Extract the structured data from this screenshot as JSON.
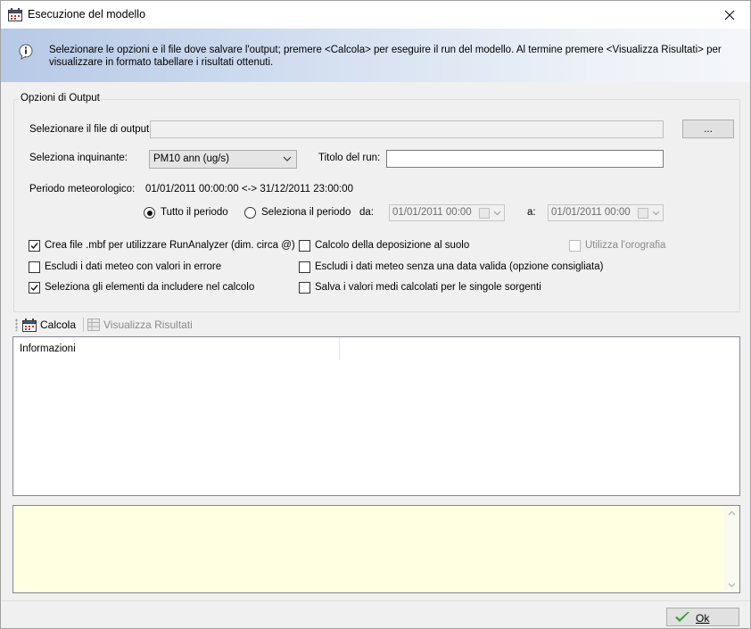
{
  "window": {
    "title": "Esecuzione del modello"
  },
  "info": {
    "message": "Selezionare le opzioni e il file dove salvare l'output; premere <Calcola> per eseguire il run del modello. Al termine premere <Visualizza Risultati> per visualizzare in formato tabellare i risultati ottenuti."
  },
  "output_options": {
    "legend": "Opzioni di Output",
    "file_label": "Selezionare il file di output:",
    "file_value": "",
    "browse_label": "...",
    "pollutant_label": "Seleziona inquinante:",
    "pollutant_value": "PM10 ann (ug/s)",
    "run_title_label": "Titolo del run:",
    "run_title_value": "",
    "met_period_label": "Periodo meteorologico:",
    "met_period_value": "01/01/2011 00:00:00 <-> 31/12/2011 23:00:00",
    "radio_all": "Tutto il periodo",
    "radio_select": "Seleziona il periodo",
    "radio_selected": "all",
    "from_label": "da:",
    "from_value": "01/01/2011 00:00",
    "to_label": "a:",
    "to_value": "01/01/2011 00:00"
  },
  "checkboxes": [
    {
      "label": "Crea file .mbf per utilizzare RunAnalyzer (dim. circa @)",
      "checked": true,
      "enabled": true
    },
    {
      "label": "Calcolo della deposizione al suolo",
      "checked": false,
      "enabled": true
    },
    {
      "label": "Utilizza l'orografia",
      "checked": false,
      "enabled": false
    },
    {
      "label": "Escludi i dati meteo con valori in errore",
      "checked": false,
      "enabled": true
    },
    {
      "label": "Escludi i dati meteo senza una data valida (opzione consigliata)",
      "checked": false,
      "enabled": true
    },
    {
      "label": "Seleziona gli elementi da includere nel calcolo",
      "checked": true,
      "enabled": true
    },
    {
      "label": "Salva i valori medi calcolati per le singole sorgenti",
      "checked": false,
      "enabled": true
    }
  ],
  "toolbar": {
    "calcola_label": "Calcola",
    "visualizza_label": "Visualizza Risultati"
  },
  "results": {
    "column_header": "Informazioni"
  },
  "footer": {
    "ok_label": "Ok"
  },
  "colors": {
    "banner_start": "#b6c9e6",
    "notes_background": "#ffffe1",
    "ok_check": "#2e9e2e"
  }
}
